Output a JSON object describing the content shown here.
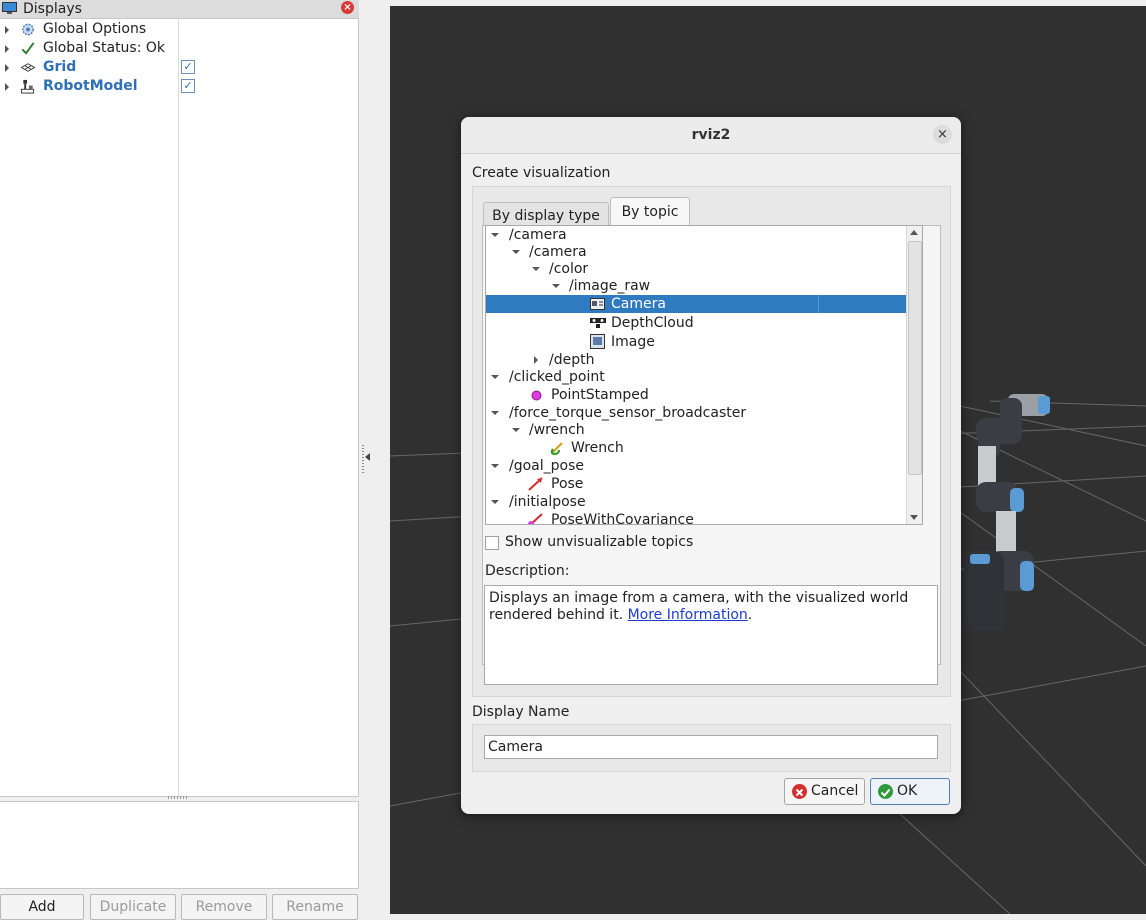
{
  "displays_panel": {
    "title": "Displays",
    "tree": [
      {
        "label": "Global Options",
        "icon": "gear-icon",
        "checked": null,
        "bold": false
      },
      {
        "label": "Global Status: Ok",
        "icon": "checkmark-icon",
        "checked": null,
        "bold": false
      },
      {
        "label": "Grid",
        "icon": "grid-icon",
        "checked": true,
        "bold": true
      },
      {
        "label": "RobotModel",
        "icon": "robot-model-icon",
        "checked": true,
        "bold": true
      }
    ],
    "buttons": {
      "add": "Add",
      "duplicate": "Duplicate",
      "remove": "Remove",
      "rename": "Rename"
    }
  },
  "dialog": {
    "title": "rviz2",
    "create_label": "Create visualization",
    "tabs": {
      "display_type": "By display type",
      "by_topic": "By topic"
    },
    "topics": {
      "camera": "/camera",
      "camera2": "/camera",
      "color": "/color",
      "image_raw": "/image_raw",
      "camera_disp": "Camera",
      "depthcloud_disp": "DepthCloud",
      "image_disp": "Image",
      "depth": "/depth",
      "clicked_point": "/clicked_point",
      "pointstamped_disp": "PointStamped",
      "force_torque": "/force_torque_sensor_broadcaster",
      "wrench": "/wrench",
      "wrench_disp": "Wrench",
      "goal_pose": "/goal_pose",
      "pose_disp": "Pose",
      "initialpose": "/initialpose",
      "posecov_disp": "PoseWithCovariance"
    },
    "selected_topic": "Camera",
    "show_unvisualizable": "Show unvisualizable topics",
    "description_label": "Description:",
    "description_text": "Displays an image from a camera, with the visualized world rendered behind it. ",
    "description_link": "More Information",
    "description_end": ".",
    "display_name_label": "Display Name",
    "display_name_value": "Camera",
    "cancel": "Cancel",
    "ok": "OK"
  },
  "colors": {
    "selection": "#2f7bc2",
    "viewport_bg": "#303030",
    "link": "#1a3ecf",
    "bold_display": "#2f6fb8"
  }
}
